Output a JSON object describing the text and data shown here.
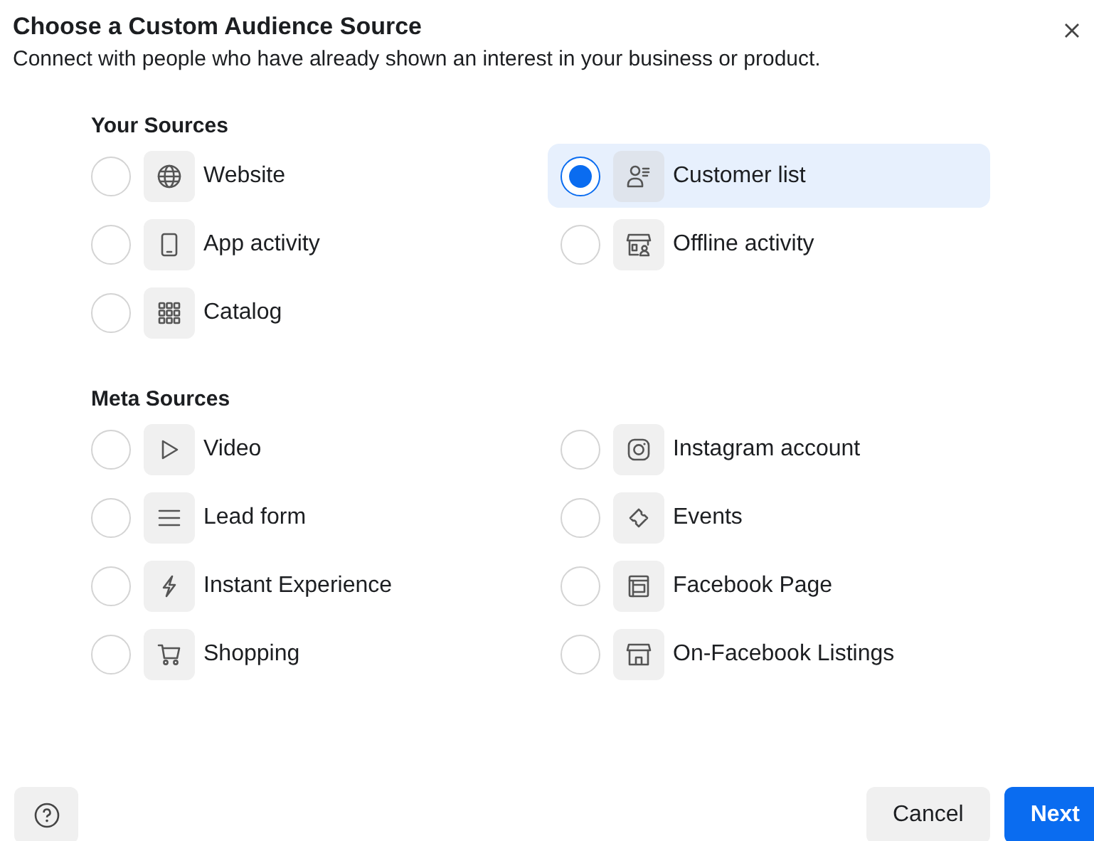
{
  "dialog": {
    "title": "Choose a Custom Audience Source",
    "subtitle": "Connect with people who have already shown an interest in your business or product."
  },
  "sections": [
    {
      "heading": "Your Sources",
      "items": [
        {
          "label": "Website",
          "kind": "globe",
          "selected": false
        },
        {
          "label": "Customer list",
          "kind": "person-list",
          "selected": true
        },
        {
          "label": "App activity",
          "kind": "phone",
          "selected": false
        },
        {
          "label": "Offline activity",
          "kind": "store-person",
          "selected": false
        },
        {
          "label": "Catalog",
          "kind": "grid",
          "selected": false
        }
      ]
    },
    {
      "heading": "Meta Sources",
      "items": [
        {
          "label": "Video",
          "kind": "play",
          "selected": false
        },
        {
          "label": "Instagram account",
          "kind": "camera",
          "selected": false
        },
        {
          "label": "Lead form",
          "kind": "lines",
          "selected": false
        },
        {
          "label": "Events",
          "kind": "ticket",
          "selected": false
        },
        {
          "label": "Instant Experience",
          "kind": "bolt",
          "selected": false
        },
        {
          "label": "Facebook Page",
          "kind": "page",
          "selected": false
        },
        {
          "label": "Shopping",
          "kind": "cart",
          "selected": false
        },
        {
          "label": "On-Facebook Listings",
          "kind": "store",
          "selected": false
        }
      ]
    }
  ],
  "footer": {
    "cancel": "Cancel",
    "next": "Next"
  }
}
